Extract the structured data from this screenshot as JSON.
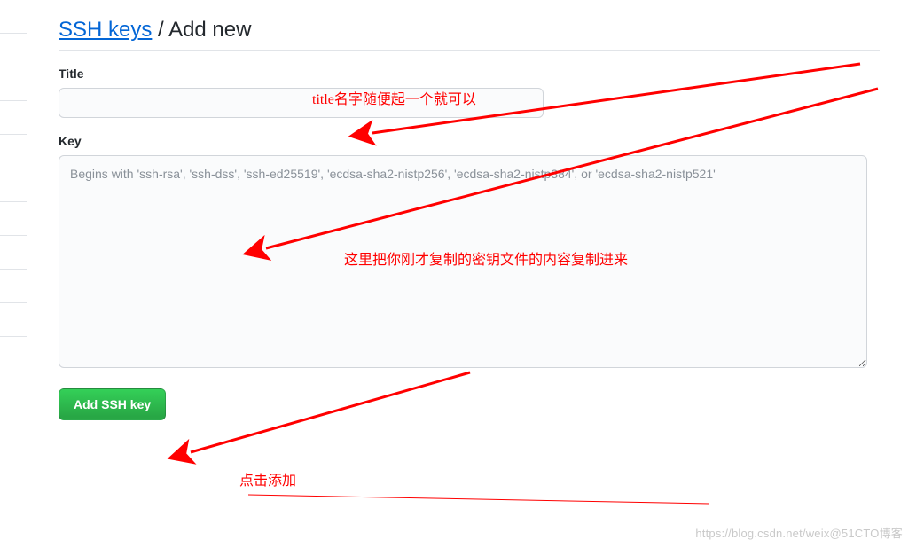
{
  "header": {
    "link_text": "SSH keys",
    "separator": " / ",
    "subtitle": "Add new"
  },
  "form": {
    "title": {
      "label": "Title",
      "value": "",
      "placeholder": ""
    },
    "key": {
      "label": "Key",
      "value": "",
      "placeholder": "Begins with 'ssh-rsa', 'ssh-dss', 'ssh-ed25519', 'ecdsa-sha2-nistp256', 'ecdsa-sha2-nistp384', or 'ecdsa-sha2-nistp521'"
    },
    "submit_label": "Add SSH key"
  },
  "annotations": {
    "title_hint": "title名字随便起一个就可以",
    "key_hint": "这里把你刚才复制的密钥文件的内容复制进来",
    "button_hint": "点击添加"
  },
  "watermark": "https://blog.csdn.net/weix@51CTO博客",
  "colors": {
    "link": "#0366d6",
    "annotation": "#ff0000",
    "button_bg": "#28a745",
    "border": "#d1d5da"
  }
}
